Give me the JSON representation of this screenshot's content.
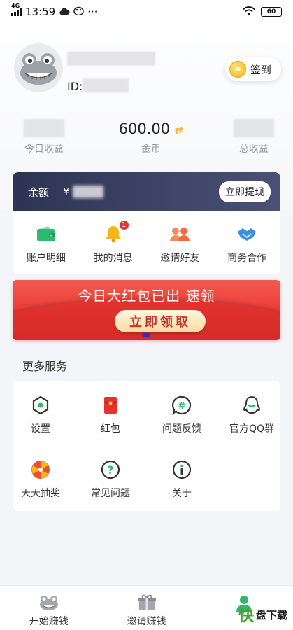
{
  "status_bar": {
    "network": "4G",
    "time": "13:59",
    "more": "···",
    "battery": "60"
  },
  "profile": {
    "id_label": "ID:",
    "checkin_label": "签到"
  },
  "stats": [
    {
      "value": "",
      "label": "今日收益"
    },
    {
      "value": "600.00",
      "label": "金币"
    },
    {
      "value": "",
      "label": "总收益"
    }
  ],
  "balance": {
    "label": "余额",
    "currency": "¥",
    "withdraw_label": "立即提现"
  },
  "quick_actions": [
    {
      "label": "账户明细",
      "icon": "wallet-icon"
    },
    {
      "label": "我的消息",
      "icon": "bell-icon",
      "badge": "1"
    },
    {
      "label": "邀请好友",
      "icon": "people-icon"
    },
    {
      "label": "商务合作",
      "icon": "handshake-icon"
    }
  ],
  "banner": {
    "title": "今日大红包已出 速领",
    "button": "立即领取"
  },
  "more_services": {
    "title": "更多服务",
    "items": [
      {
        "label": "设置",
        "icon": "settings-icon"
      },
      {
        "label": "红包",
        "icon": "red-packet-icon"
      },
      {
        "label": "问题反馈",
        "icon": "feedback-icon"
      },
      {
        "label": "官方QQ群",
        "icon": "qq-icon"
      },
      {
        "label": "天天抽奖",
        "icon": "lottery-wheel-icon"
      },
      {
        "label": "常见问题",
        "icon": "faq-icon"
      },
      {
        "label": "关于",
        "icon": "info-icon"
      }
    ]
  },
  "bottom_nav": [
    {
      "label": "开始赚钱",
      "icon": "frog-icon"
    },
    {
      "label": "邀请赚钱",
      "icon": "gift-icon"
    },
    {
      "label": "",
      "icon": "user-icon",
      "active": true
    }
  ],
  "watermark": {
    "logo": "快",
    "text": "盘下载"
  },
  "colors": {
    "brand_red": "#e8312f",
    "card_dark": "#3e4468",
    "accent_green": "#2cbb6c",
    "coin_gold": "#f3b81c"
  }
}
